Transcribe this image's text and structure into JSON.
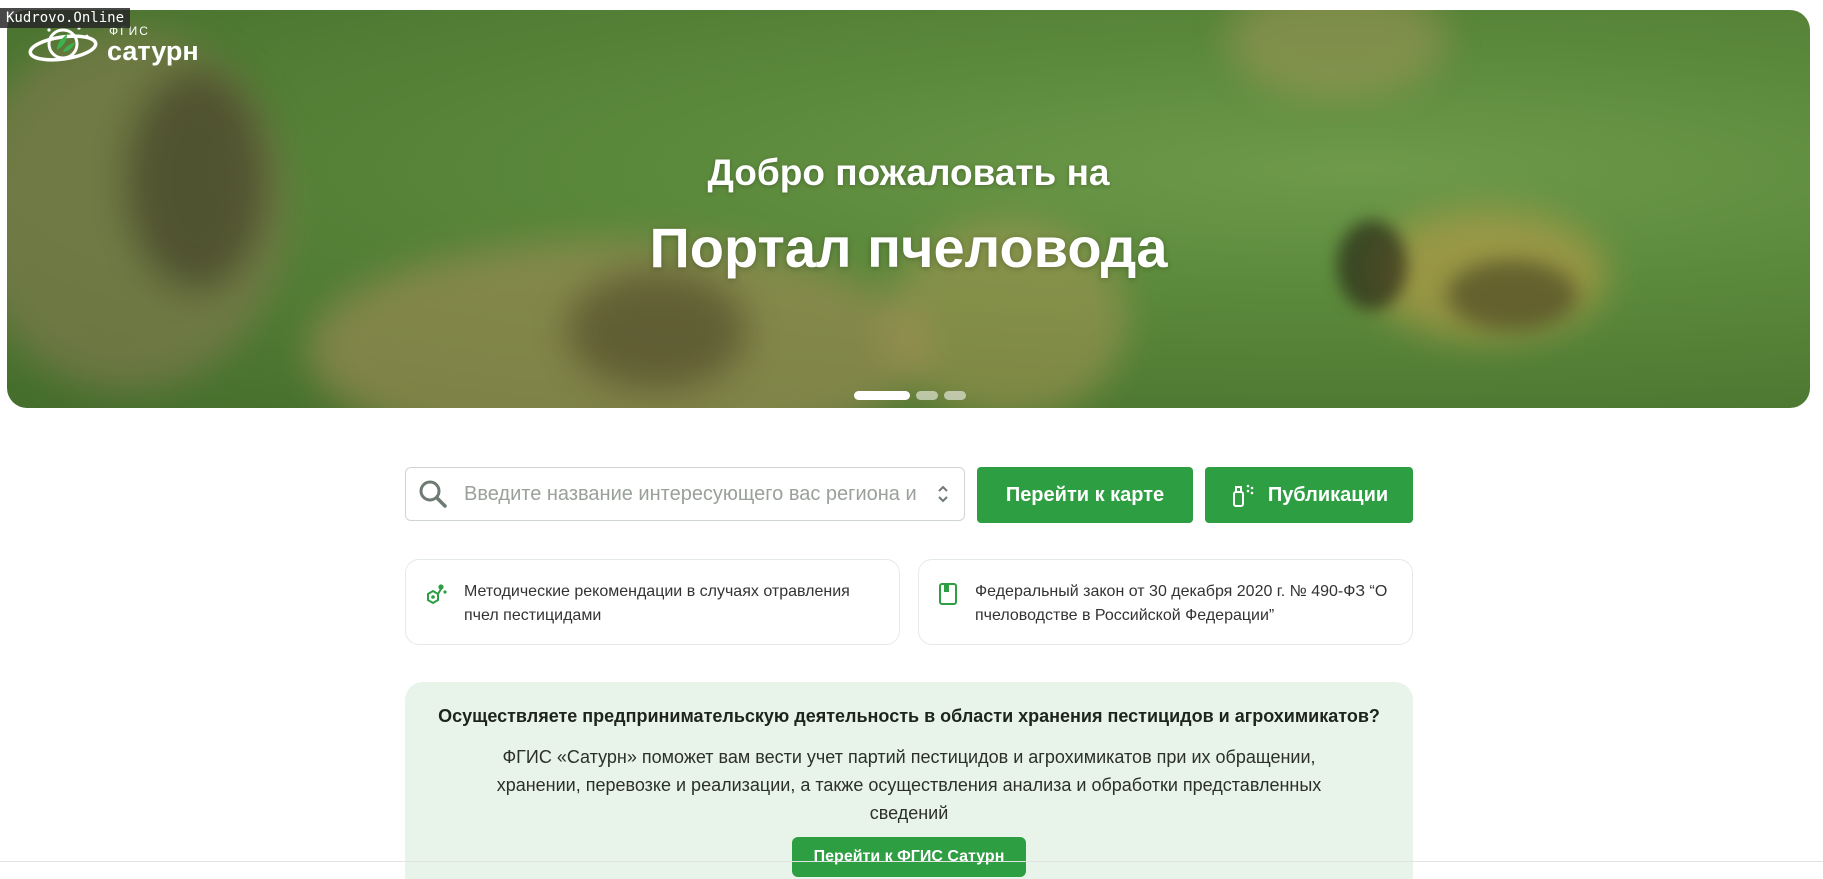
{
  "watermark": "Kudrovo.Online",
  "logo": {
    "small": "ФГИС",
    "big": "сатурн"
  },
  "hero": {
    "subtitle": "Добро пожаловать на",
    "title": "Портал пчеловода",
    "slides_total": 3,
    "active_slide": 1
  },
  "search": {
    "placeholder": "Введите название интересующего вас региона и",
    "value": ""
  },
  "buttons": {
    "map": "Перейти к карте",
    "publications": "Публикации"
  },
  "cards": [
    {
      "text": "Методические рекомендации в случаях отравления пчел пестицидами",
      "icon": "molecule-icon"
    },
    {
      "text": "Федеральный закон от 30 декабря 2020 г. № 490-ФЗ “О пчеловодстве в Российской Федерации”",
      "icon": "document-icon"
    }
  ],
  "info": {
    "question": "Осуществляете предпринимательскую деятельность в области хранения пестицидов и агрохимикатов?",
    "text": "ФГИС «Сатурн» поможет вам вести учет партий пестицидов и агрохимикатов при их обращении, хранении, перевозке и реализации, а также осуществления анализа и обработки представленных сведений",
    "button": "Перейти к ФГИС Сатурн"
  },
  "colors": {
    "accent": "#2e9e43",
    "panel": "#e8f3ea",
    "hero_green": "#5c8a3c"
  }
}
